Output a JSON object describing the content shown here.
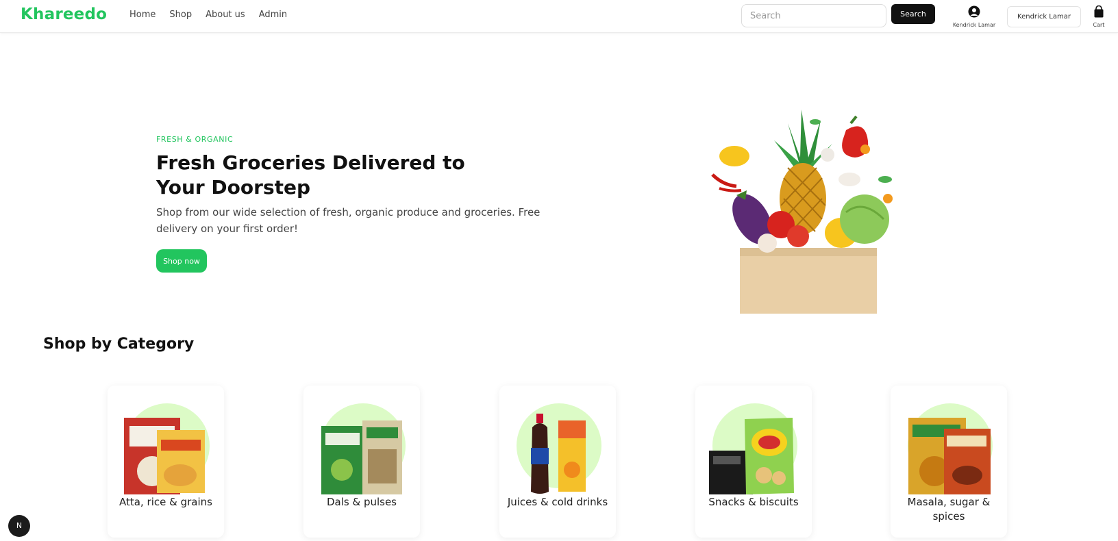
{
  "nav": {
    "brand": "Khareedo",
    "links": [
      "Home",
      "Shop",
      "About us",
      "Admin"
    ],
    "search_placeholder": "Search",
    "search_button": "Search",
    "user_label": "Kendrick Lamar",
    "user_button": "Kendrick Lamar",
    "cart_label": "Cart"
  },
  "hero": {
    "eyebrow": "FRESH & ORGANIC",
    "title": "Fresh Groceries Delivered to Your Doorstep",
    "subtitle": "Shop from our wide selection of fresh, organic produce and groceries. Free delivery on your first order!",
    "cta": "Shop now"
  },
  "categories": {
    "heading": "Shop by Category",
    "items": [
      {
        "label": "Atta, rice & grains"
      },
      {
        "label": "Dals & pulses"
      },
      {
        "label": "Juices & cold drinks"
      },
      {
        "label": "Snacks & biscuits"
      },
      {
        "label": "Masala, sugar & spices"
      }
    ]
  },
  "floating_badge": "N",
  "colors": {
    "brand_green": "#22c55e",
    "dark": "#111111",
    "category_circle": "#dcfbc6"
  }
}
